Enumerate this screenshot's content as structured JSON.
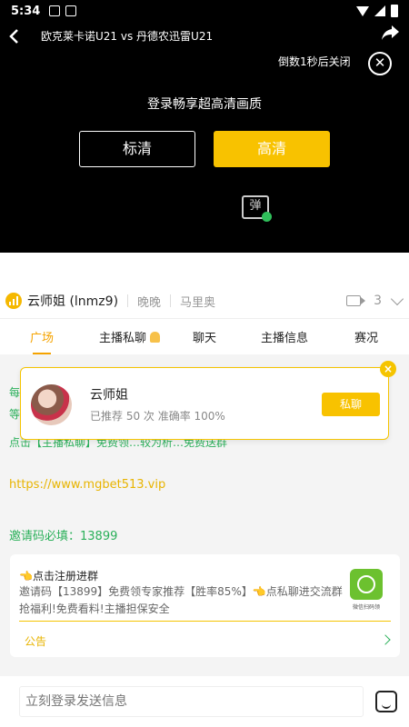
{
  "status_bar": {
    "time": "5:34"
  },
  "player": {
    "match_title": "欧克莱卡诺U21 vs 丹德农迅雷U21",
    "countdown_text": "倒数1秒后关闭",
    "login_tip": "登录畅享超高清画质",
    "quality_sd": "标清",
    "quality_hd": "高清",
    "danmu_label": "弹"
  },
  "anchor": {
    "name": "云师姐 (lnmz9)",
    "tag1": "晚晚",
    "tag2": "马里奥",
    "viewer_count": "3"
  },
  "tabs": [
    {
      "label": "广场"
    },
    {
      "label": "主播私聊"
    },
    {
      "label": "聊天"
    },
    {
      "label": "主播信息"
    },
    {
      "label": "赛况"
    }
  ],
  "chat": {
    "partial_line_1": "每",
    "partial_line_2": "等",
    "partial_line_3": "点击【主播私聊】免费领…较为析…免费送群",
    "link": "https://www.mgbet513.vip",
    "invite": "邀请码必填：13899"
  },
  "promo": {
    "title": "👈点击注册进群",
    "body": "邀请码【13899】免费领专家推荐【胜率85%】👈点私聊进交流群抢福利!免费看料!主播担保安全",
    "qr_label": "微信扫码领",
    "notice": "公告"
  },
  "card": {
    "name": "云师姐",
    "stats": "已推荐 50 次 准确率 100%",
    "button": "私聊"
  },
  "input": {
    "placeholder": "立刻登录发送信息"
  },
  "colors": {
    "accent": "#f8c200",
    "green": "#2bb05a"
  }
}
